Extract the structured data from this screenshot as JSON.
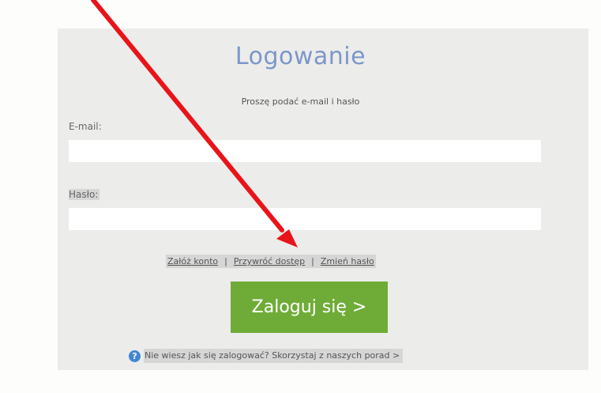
{
  "login": {
    "title": "Logowanie",
    "subtitle": "Proszę podać e-mail i hasło",
    "email_label": "E-mail:",
    "email_value": "",
    "password_label": "Hasło:",
    "password_value": ""
  },
  "links": {
    "create_account": "Załóż konto",
    "separator_1": "|",
    "restore_access": "Przywróć dostęp",
    "separator_2": "|",
    "change_password": "Zmień hasło"
  },
  "login_button": {
    "label": "Zaloguj się >"
  },
  "help": {
    "icon": "question-circle-icon",
    "icon_glyph": "?",
    "text": "Nie wiesz jak się zalogować? Skorzystaj z naszych porad >"
  },
  "annotation": {
    "type": "red-arrow",
    "color": "#e8141a"
  },
  "colors": {
    "panel": "#ececea",
    "title": "#7b97c9",
    "button": "#6fac37",
    "help_icon": "#3f87d2"
  }
}
